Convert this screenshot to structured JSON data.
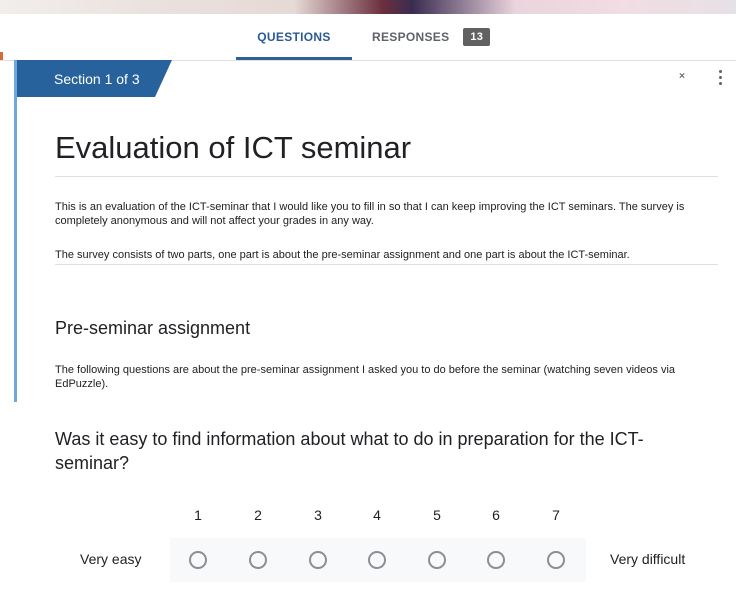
{
  "tabs": {
    "questions": "QUESTIONS",
    "responses": "RESPONSES",
    "responses_count": "13"
  },
  "section": {
    "indicator": "Section 1 of 3"
  },
  "form": {
    "title": "Evaluation of ICT seminar",
    "description_p1": "This is an evaluation of the ICT-seminar that I would like you to fill in so that I can keep improving the ICT seminars. The survey is completely anonymous and will not affect your grades in any way.",
    "description_p2": "The survey consists of two parts, one part is about the pre-seminar assignment and one part is about the ICT-seminar."
  },
  "subsection": {
    "title": "Pre-seminar assignment",
    "description": "The following questions are about the pre-seminar assignment I asked you to do before the seminar (watching seven videos via EdPuzzle)."
  },
  "question": {
    "text": "Was it easy to find information about what to do in preparation for the ICT-seminar?",
    "scale_labels": [
      "1",
      "2",
      "3",
      "4",
      "5",
      "6",
      "7"
    ],
    "min_label": "Very easy",
    "max_label": "Very difficult"
  },
  "icons": {
    "collapse": "collapse-section-icon",
    "more": "more-vert-icon"
  },
  "colors": {
    "section_tab": "#28629c",
    "active_tab": "#2a5a95",
    "badge": "#616161",
    "left_accent": "#6fa8dc"
  }
}
